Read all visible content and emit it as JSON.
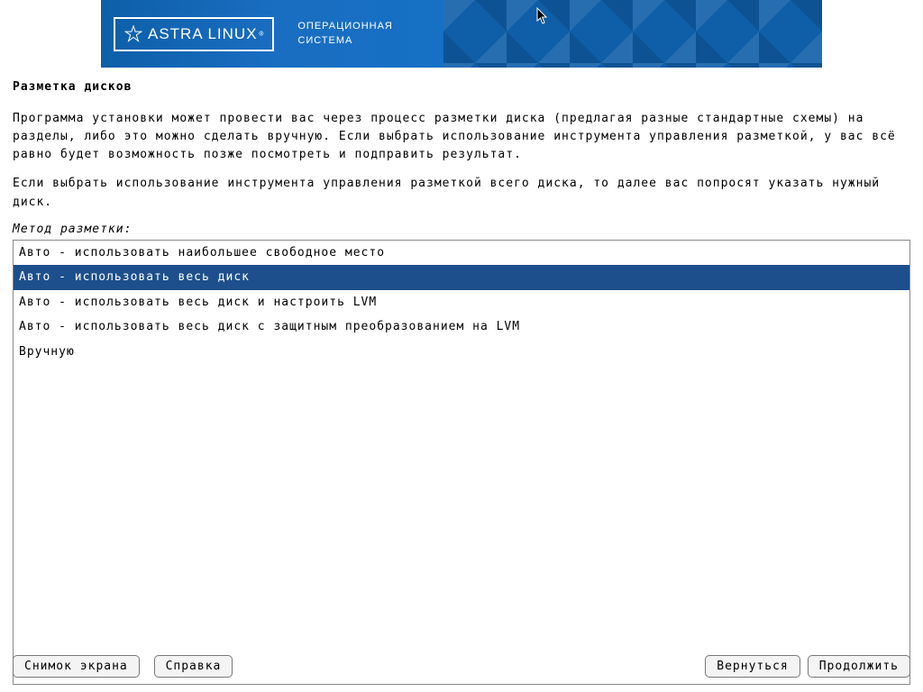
{
  "banner": {
    "logo_text": "ASTRA LINUX",
    "subtitle_line1": "ОПЕРАЦИОННАЯ",
    "subtitle_line2": "СИСТЕМА"
  },
  "page": {
    "title": "Разметка дисков",
    "para1": "Программа установки может провести вас через процесс разметки диска (предлагая разные стандартные схемы) на разделы, либо это можно сделать вручную. Если выбрать использование инструмента управления разметкой, у вас всё равно будет возможность позже посмотреть и подправить результат.",
    "para2": "Если выбрать использование инструмента управления разметкой всего диска, то далее вас попросят указать нужный диск.",
    "method_label": "Метод разметки:"
  },
  "methods": {
    "items": [
      {
        "label": "Авто - использовать наибольшее свободное место",
        "selected": false
      },
      {
        "label": "Авто - использовать весь диск",
        "selected": true
      },
      {
        "label": "Авто - использовать весь диск и настроить LVM",
        "selected": false
      },
      {
        "label": "Авто - использовать весь диск с защитным преобразованием на LVM",
        "selected": false
      },
      {
        "label": "Вручную",
        "selected": false
      }
    ]
  },
  "footer": {
    "screenshot": "Снимок экрана",
    "help": "Справка",
    "back": "Вернуться",
    "continue": "Продолжить"
  }
}
